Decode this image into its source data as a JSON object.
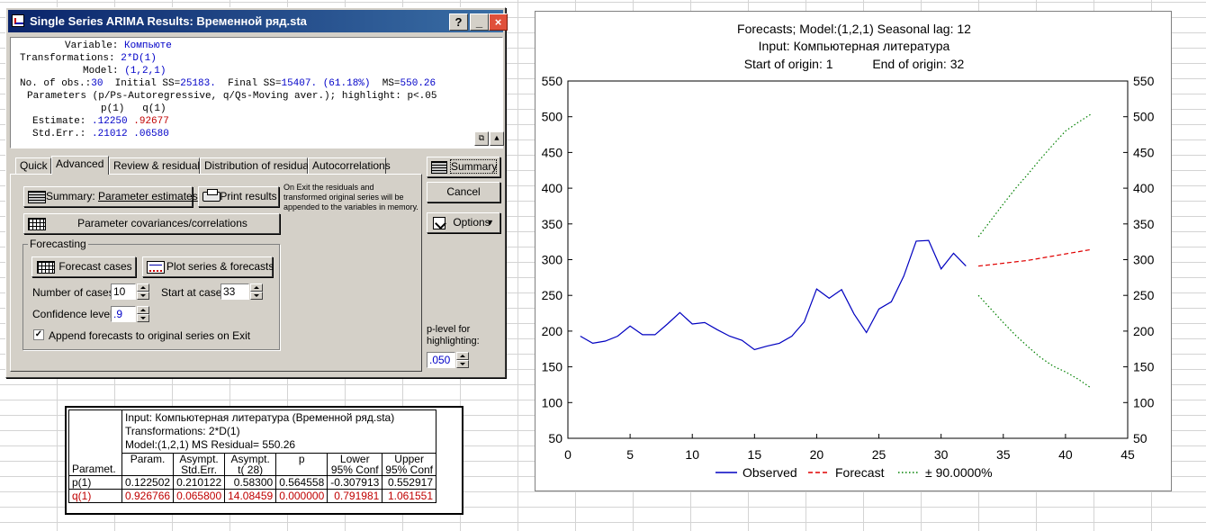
{
  "dialog": {
    "title": "Single Series ARIMA Results: Временной ряд.sta",
    "results": {
      "variable_label": "Variable:",
      "variable_value": "Компьюте",
      "transformations_label": "Transformations:",
      "transformations_value": "2*D(1)",
      "model_label": "Model:",
      "model_value": "(1,2,1)",
      "obs_label": "No. of obs.:",
      "obs_value": "30",
      "initial_ss_label": "Initial SS=",
      "initial_ss_value": "25183.",
      "final_ss_label": "Final SS=",
      "final_ss_value": "15407. (61.18%)",
      "ms_label": "MS=",
      "ms_value": "550.26",
      "params_line": "Parameters (p/Ps-Autoregressive, q/Qs-Moving aver.); highlight: p<.05",
      "col_p": "p(1)",
      "col_q": "q(1)",
      "estimate_label": "Estimate:",
      "estimate_p": ".12250",
      "estimate_q": ".92677",
      "stderr_label": "Std.Err.:",
      "stderr_p": ".21012",
      "stderr_q": ".06580"
    },
    "tabs": [
      {
        "label": "Quick"
      },
      {
        "label": "Advanced"
      },
      {
        "label": "Review & residuals"
      },
      {
        "label": "Distribution of residuals"
      },
      {
        "label": "Autocorrelations"
      }
    ],
    "buttons": {
      "summary_params_prefix": "Summary: ",
      "summary_params_main": "Parameter estimates",
      "print_results": "Print results",
      "param_cov": "Parameter covariances/correlations",
      "forecast_cases": "Forecast cases",
      "plot_series": "Plot series & forecasts",
      "summary": "Summary",
      "cancel": "Cancel",
      "options": "Options"
    },
    "note": "On Exit the residuals and transformed original series will be appended to the variables in memory.",
    "forecasting": {
      "group_label": "Forecasting",
      "num_cases_label": "Number of cases:",
      "num_cases_value": "10",
      "start_case_label": "Start at case:",
      "start_case_value": "33",
      "confidence_label": "Confidence level:",
      "confidence_value": ".9",
      "append_label": "Append forecasts to original series on Exit",
      "append_checked": true,
      "append_mark": "✓"
    },
    "plevel": {
      "label_line1": "p-level for",
      "label_line2": "highlighting:",
      "value": ".050"
    }
  },
  "table": {
    "info_line1": "Input: Компьютерная литература (Временной ряд.sta)",
    "info_line2": "Transformations: 2*D(1)",
    "info_line3": "Model:(1,2,1) MS Residual= 550.26",
    "row_header": "Paramet.",
    "columns": [
      {
        "l1": "Param.",
        "l2": ""
      },
      {
        "l1": "Asympt.",
        "l2": "Std.Err."
      },
      {
        "l1": "Asympt.",
        "l2": "t(   28)"
      },
      {
        "l1": "p",
        "l2": ""
      },
      {
        "l1": "Lower",
        "l2": "95% Conf"
      },
      {
        "l1": "Upper",
        "l2": "95% Conf"
      }
    ],
    "rows": [
      {
        "name": "p(1)",
        "highlight": false,
        "values": [
          "0.122502",
          "0.210122",
          "0.58300",
          "0.564558",
          "-0.307913",
          "0.552917"
        ]
      },
      {
        "name": "q(1)",
        "highlight": true,
        "values": [
          "0.926766",
          "0.065800",
          "14.08459",
          "0.000000",
          "0.791981",
          "1.061551"
        ]
      }
    ]
  },
  "chart_data": {
    "type": "line",
    "title_line1": "Forecasts; Model:(1,2,1) Seasonal lag: 12",
    "title_line2": "Input: Компьютерная литература",
    "title_line3_a": "Start of origin: 1",
    "title_line3_b": "End of origin: 32",
    "xlim": [
      0,
      45
    ],
    "ylim": [
      50,
      550
    ],
    "x_ticks": [
      0,
      5,
      10,
      15,
      20,
      25,
      30,
      35,
      40,
      45
    ],
    "y_ticks": [
      50,
      100,
      150,
      200,
      250,
      300,
      350,
      400,
      450,
      500,
      550
    ],
    "grid": false,
    "legend_position": "bottom",
    "series": [
      {
        "name": "Observed",
        "color": "#0000c0",
        "dash": "solid",
        "x": [
          1,
          2,
          3,
          4,
          5,
          6,
          7,
          8,
          9,
          10,
          11,
          12,
          13,
          14,
          15,
          16,
          17,
          18,
          19,
          20,
          21,
          22,
          23,
          24,
          25,
          26,
          27,
          28,
          29,
          30,
          31,
          32
        ],
        "y": [
          193,
          183,
          186,
          193,
          207,
          195,
          195,
          210,
          226,
          210,
          212,
          202,
          193,
          187,
          174,
          179,
          183,
          193,
          213,
          259,
          246,
          258,
          224,
          198,
          231,
          241,
          277,
          326,
          327,
          287,
          309,
          291
        ]
      },
      {
        "name": "Forecast",
        "color": "#e00000",
        "dash": "dashed",
        "x": [
          33,
          34,
          35,
          36,
          37,
          38,
          39,
          40,
          41,
          42
        ],
        "y": [
          291,
          293,
          295,
          297,
          299,
          302,
          305,
          308,
          311,
          314
        ]
      },
      {
        "name": "± 90.0000%",
        "color": "#008000",
        "dash": "dotted",
        "x": [
          33,
          34,
          35,
          36,
          37,
          38,
          39,
          40,
          41,
          42
        ],
        "y": [
          332,
          355,
          378,
          400,
          420,
          441,
          461,
          480,
          492,
          503
        ],
        "y2": [
          250,
          231,
          212,
          194,
          178,
          163,
          151,
          143,
          133,
          121
        ]
      }
    ]
  }
}
